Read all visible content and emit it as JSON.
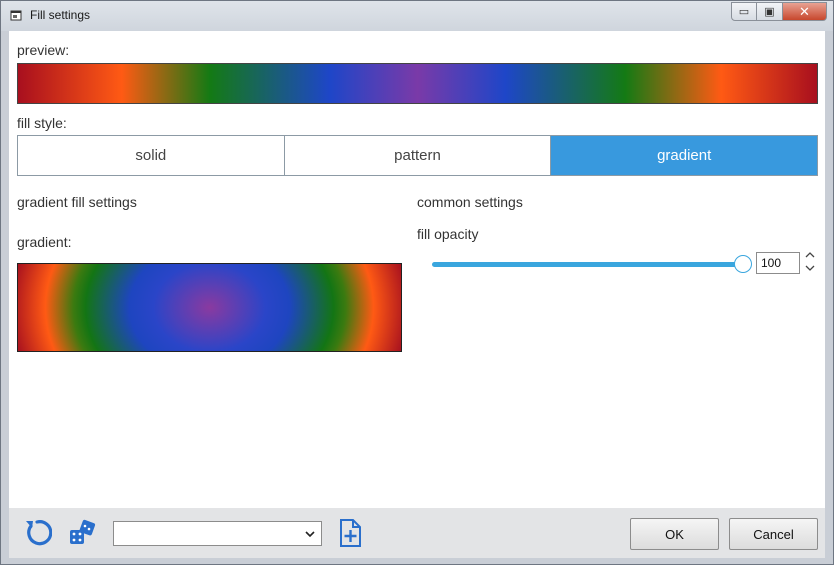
{
  "window": {
    "title": "Fill settings",
    "controls": {
      "minimize": "▭",
      "maximize": "▣",
      "close": "✕"
    }
  },
  "preview": {
    "label": "preview:"
  },
  "fill_style": {
    "label": "fill style:",
    "options": [
      "solid",
      "pattern",
      "gradient"
    ],
    "selected": "gradient"
  },
  "gradient_settings": {
    "heading": "gradient fill settings",
    "gradient_label": "gradient:",
    "stops": [
      "#a80f1e",
      "#ff5a14",
      "#147a14",
      "#1e46c8",
      "#7a3aa8"
    ]
  },
  "common_settings": {
    "heading": "common settings",
    "opacity_label": "fill opacity",
    "opacity_value": "100",
    "opacity_fraction": 1.0
  },
  "footer": {
    "icons": [
      "reset-icon",
      "dice-icon",
      "chevron-down-icon",
      "add-document-icon"
    ],
    "combo_value": "",
    "ok_label": "OK",
    "cancel_label": "Cancel"
  },
  "colors": {
    "accent": "#3899de",
    "slider": "#3aa6de",
    "footer_icon": "#2a6fcc"
  }
}
